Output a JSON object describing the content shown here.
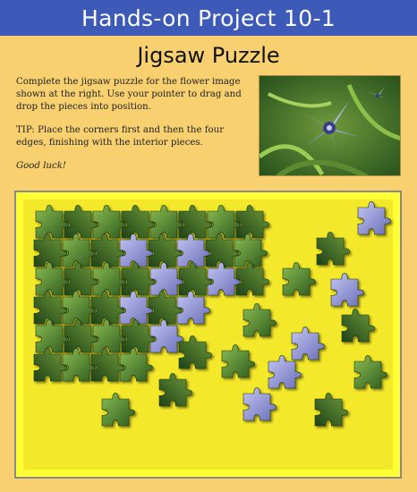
{
  "header": {
    "title": "Hands-on Project 10-1"
  },
  "page": {
    "title": "Jigsaw Puzzle"
  },
  "instructions": {
    "line1": "Complete the jigsaw puzzle for the flower image shown at the right. Use your pointer to drag and drop the pieces into position.",
    "line2": "TIP: Place the corners first and then the four edges, finishing with the interior pieces.",
    "line3": "Good luck!"
  },
  "colors": {
    "header_bg": "#3e5ab8",
    "page_bg": "#f8d070",
    "board_bg": "#ffff33",
    "leaf_green": "#4e7a2e",
    "petal_blue": "#8c8fd0"
  },
  "photo": {
    "name": "flower-reference-image"
  },
  "puzzle": {
    "name": "jigsaw-board"
  }
}
